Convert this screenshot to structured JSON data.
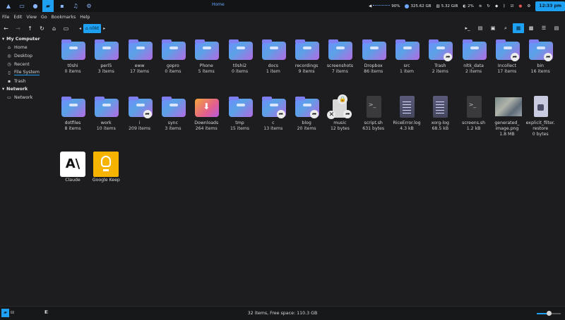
{
  "panel": {
    "title": "Home",
    "tray": {
      "volume": "90%",
      "disk_used": "325.62 GB",
      "ram": "5.32 GiB",
      "cpu": "2%",
      "clock": "12:33 pm"
    }
  },
  "menubar": [
    "File",
    "Edit",
    "View",
    "Go",
    "Bookmarks",
    "Help"
  ],
  "breadcrumb": {
    "current": "n0kt"
  },
  "sidebar": {
    "sections": [
      {
        "title": "My Computer",
        "items": [
          {
            "label": "Home",
            "icon": "home-icon"
          },
          {
            "label": "Desktop",
            "icon": "desktop-icon"
          },
          {
            "label": "Recent",
            "icon": "clock-icon"
          },
          {
            "label": "File System",
            "icon": "drive-icon",
            "selected": true
          },
          {
            "label": "Trash",
            "icon": "trash-icon"
          }
        ]
      },
      {
        "title": "Network",
        "items": [
          {
            "label": "Network",
            "icon": "network-icon"
          }
        ]
      }
    ]
  },
  "files": [
    {
      "name": "t0shi",
      "meta": "0 items",
      "kind": "folder"
    },
    {
      "name": "perl5",
      "meta": "3 items",
      "kind": "folder"
    },
    {
      "name": "eww",
      "meta": "17 items",
      "kind": "folder"
    },
    {
      "name": "gopro",
      "meta": "0 items",
      "kind": "folder"
    },
    {
      "name": "Phone",
      "meta": "5 items",
      "kind": "folder"
    },
    {
      "name": "t0shi2",
      "meta": "0 items",
      "kind": "folder"
    },
    {
      "name": "docs",
      "meta": "1 item",
      "kind": "folder"
    },
    {
      "name": "recordings",
      "meta": "9 items",
      "kind": "folder"
    },
    {
      "name": "screenshots",
      "meta": "7 items",
      "kind": "folder"
    },
    {
      "name": "Dropbox",
      "meta": "86 items",
      "kind": "folder"
    },
    {
      "name": "src",
      "meta": "1 item",
      "kind": "folder"
    },
    {
      "name": "Trash",
      "meta": "2 items",
      "kind": "folder-link"
    },
    {
      "name": "nltk_data",
      "meta": "2 items",
      "kind": "folder"
    },
    {
      "name": "Incollect",
      "meta": "17 items",
      "kind": "folder-link"
    },
    {
      "name": "bin",
      "meta": "16 items",
      "kind": "folder-link"
    },
    {
      "name": "dotfiles",
      "meta": "8 items",
      "kind": "folder"
    },
    {
      "name": "work",
      "meta": "10 items",
      "kind": "folder"
    },
    {
      "name": "i",
      "meta": "209 items",
      "kind": "folder-link"
    },
    {
      "name": "sync",
      "meta": "3 items",
      "kind": "folder"
    },
    {
      "name": "Downloads",
      "meta": "264 items",
      "kind": "downloads"
    },
    {
      "name": "tmp",
      "meta": "15 items",
      "kind": "folder"
    },
    {
      "name": "c",
      "meta": "13 items",
      "kind": "folder-link"
    },
    {
      "name": "blog",
      "meta": "20 items",
      "kind": "folder-link"
    },
    {
      "name": "music",
      "meta": "12 bytes",
      "kind": "broken-link"
    },
    {
      "name": "script.sh",
      "meta": "631 bytes",
      "kind": "script"
    },
    {
      "name": "RiceError.log",
      "meta": "4.3 kB",
      "kind": "text"
    },
    {
      "name": "xorg-log",
      "meta": "68.5 kB",
      "kind": "text"
    },
    {
      "name": "screens.sh",
      "meta": "1.2 kB",
      "kind": "script"
    },
    {
      "name": "generated_ image.png",
      "meta": "1.8 MB",
      "kind": "image"
    },
    {
      "name": "explicit_filter. restore",
      "meta": "0 bytes",
      "kind": "restore"
    },
    {
      "name": "Claude",
      "meta": "",
      "kind": "app-claude"
    },
    {
      "name": "Google Keep",
      "meta": "",
      "kind": "app-keep"
    }
  ],
  "status": {
    "text": "32 items, Free space: 110.3 GB",
    "zoom": 0.6
  },
  "colors": {
    "accent": "#1ea1f2",
    "background": "#1d1d1f"
  }
}
